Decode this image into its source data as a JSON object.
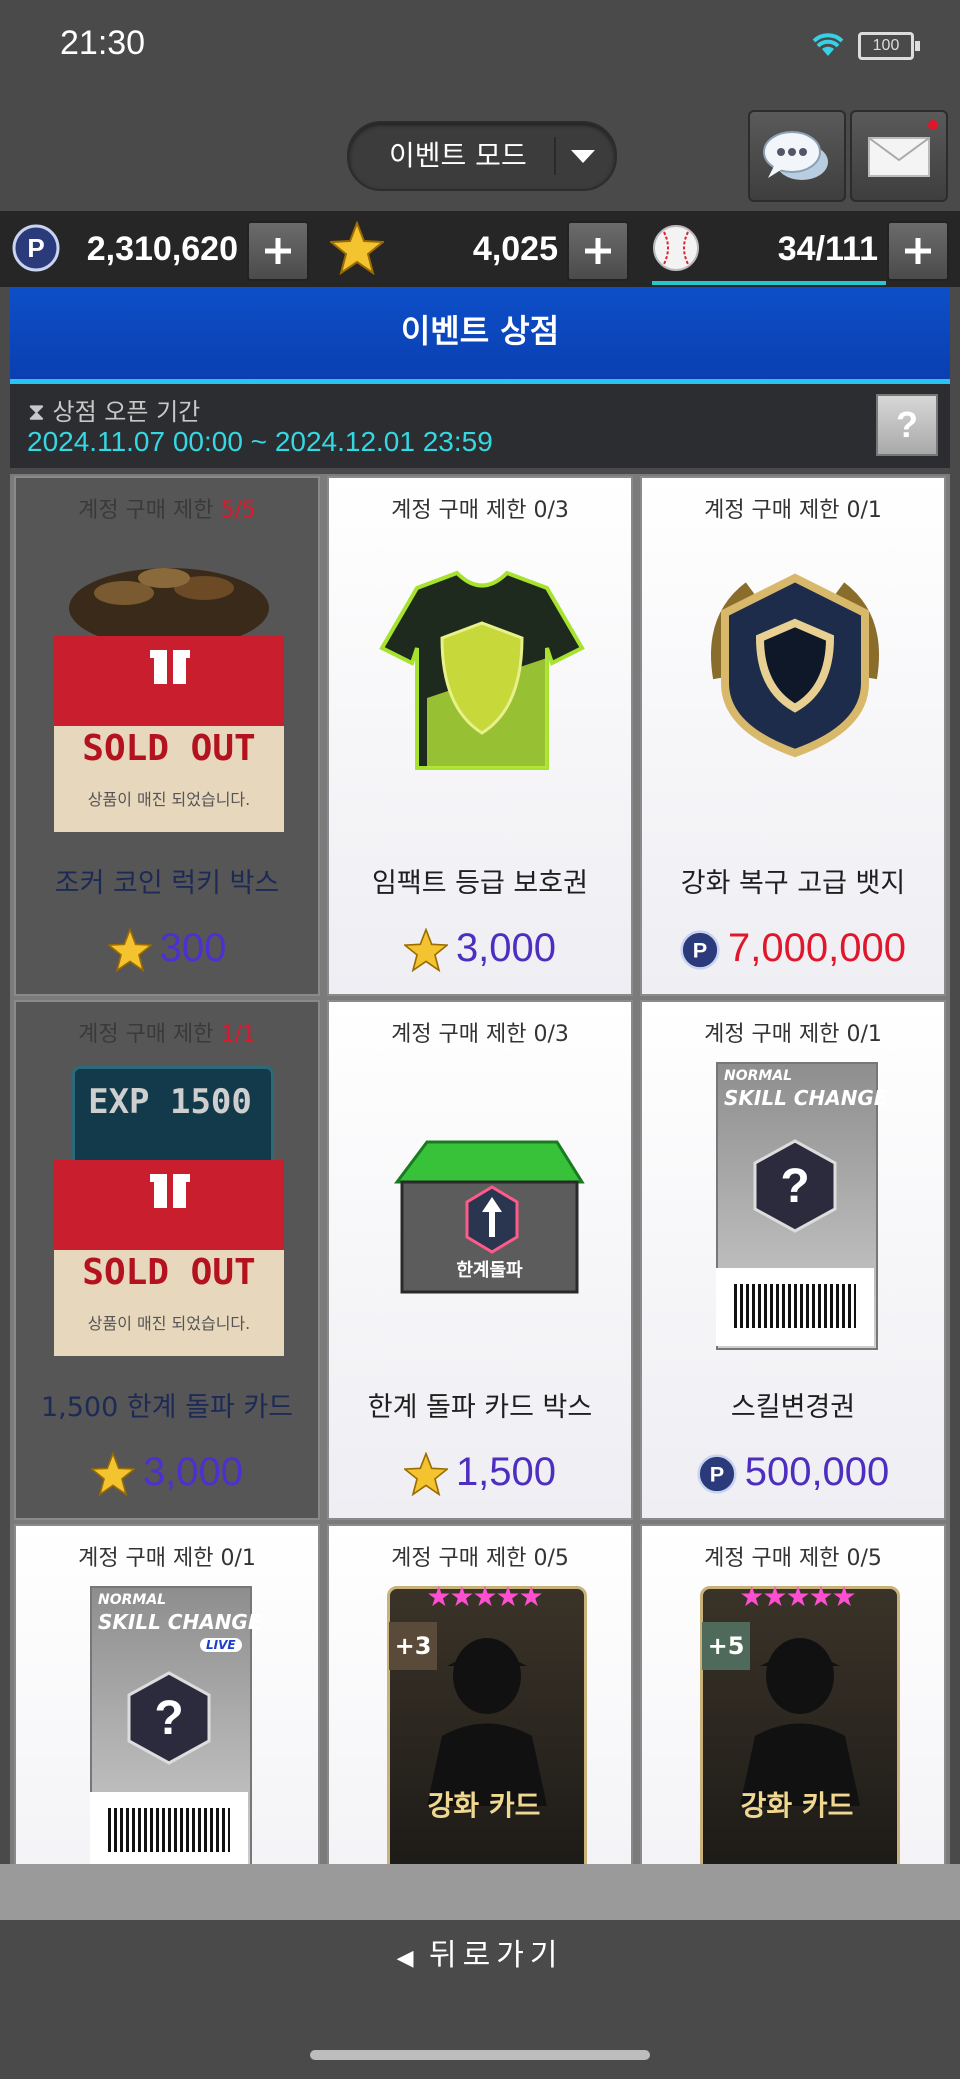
{
  "status_bar": {
    "time": "21:30",
    "battery": "100"
  },
  "header": {
    "mode_label": "이벤트 모드"
  },
  "currency": {
    "points": "2,310,620",
    "stars": "4,025",
    "tickets": "34/111"
  },
  "shop": {
    "title": "이벤트 상점",
    "period_label": "상점 오픈 기간",
    "period_range": "2024.11.07 00:00 ~ 2024.12.01 23:59",
    "help_label": "?"
  },
  "sold_out": {
    "main": "SOLD OUT",
    "sub": "상품이 매진 되었습니다."
  },
  "items": [
    {
      "limit_prefix": "계정 구매 제한 ",
      "limit_count": "5/5",
      "name": "조커 코인 럭키 박스",
      "price": "300",
      "currency": "star-icon",
      "sold_out": true
    },
    {
      "limit_prefix": "계정 구매 제한 ",
      "limit_count": "0/3",
      "name": "임팩트 등급 보호권",
      "price": "3,000",
      "currency": "star-icon",
      "sold_out": false
    },
    {
      "limit_prefix": "계정 구매 제한 ",
      "limit_count": "0/1",
      "name": "강화 복구 고급 뱃지",
      "price": "7,000,000",
      "currency": "point-icon",
      "sold_out": false
    },
    {
      "limit_prefix": "계정 구매 제한 ",
      "limit_count": "1/1",
      "name": "1,500 한계 돌파 카드",
      "price": "3,000",
      "currency": "star-icon",
      "sold_out": true
    },
    {
      "limit_prefix": "계정 구매 제한 ",
      "limit_count": "0/3",
      "name": "한계 돌파 카드 박스",
      "price": "1,500",
      "currency": "star-icon",
      "sold_out": false
    },
    {
      "limit_prefix": "계정 구매 제한 ",
      "limit_count": "0/1",
      "name": "스킬변경권",
      "price": "500,000",
      "currency": "point-icon",
      "sold_out": false
    },
    {
      "limit_prefix": "계정 구매 제한 ",
      "limit_count": "0/1",
      "name": "",
      "price": "",
      "currency": "",
      "sold_out": false
    },
    {
      "limit_prefix": "계정 구매 제한 ",
      "limit_count": "0/5",
      "name": "",
      "price": "",
      "currency": "",
      "sold_out": false
    },
    {
      "limit_prefix": "계정 구매 제한 ",
      "limit_count": "0/5",
      "name": "",
      "price": "",
      "currency": "",
      "sold_out": false
    }
  ],
  "art_text": {
    "exp_badge": "EXP 1500",
    "limit_break": "한계돌파",
    "skill_normal": "NORMAL",
    "skill_change": "SKILL CHANGE",
    "skill_live": "LIVE",
    "enhance_label": "강화 카드",
    "enhance_plus3": "+3",
    "enhance_plus5": "+5"
  },
  "footer": {
    "back_label": "뒤로가기"
  },
  "colors": {
    "accent_blue": "#0d4fc8",
    "cyan": "#34d8e2",
    "price_purple": "#4d2ec0",
    "price_red": "#e0162b"
  }
}
